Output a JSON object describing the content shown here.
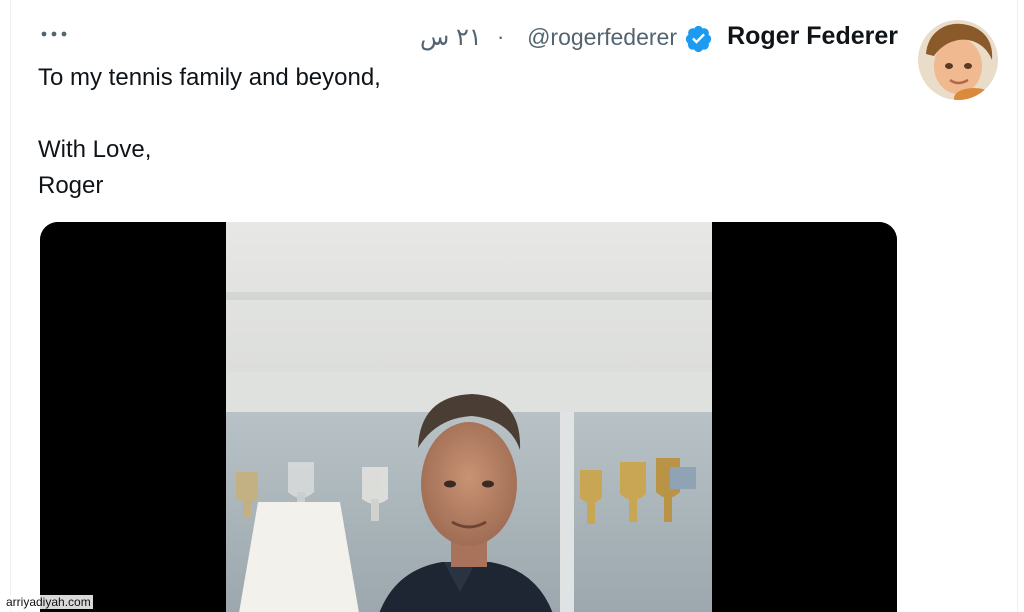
{
  "tweet": {
    "author_name": "Roger Federer",
    "handle": "@rogerfederer",
    "separator": "·",
    "time": "٢١ س",
    "more_icon": "more-horizontal-icon",
    "verified_icon": "verified-badge-icon",
    "text_lines": [
      "To my tennis family and beyond,",
      "",
      "With Love,",
      "Roger"
    ]
  },
  "media": {
    "type": "video"
  },
  "watermark": "arriyadiyah.com",
  "colors": {
    "text_primary": "#0f1419",
    "text_secondary": "#536471",
    "verified_blue": "#1d9bf0"
  }
}
